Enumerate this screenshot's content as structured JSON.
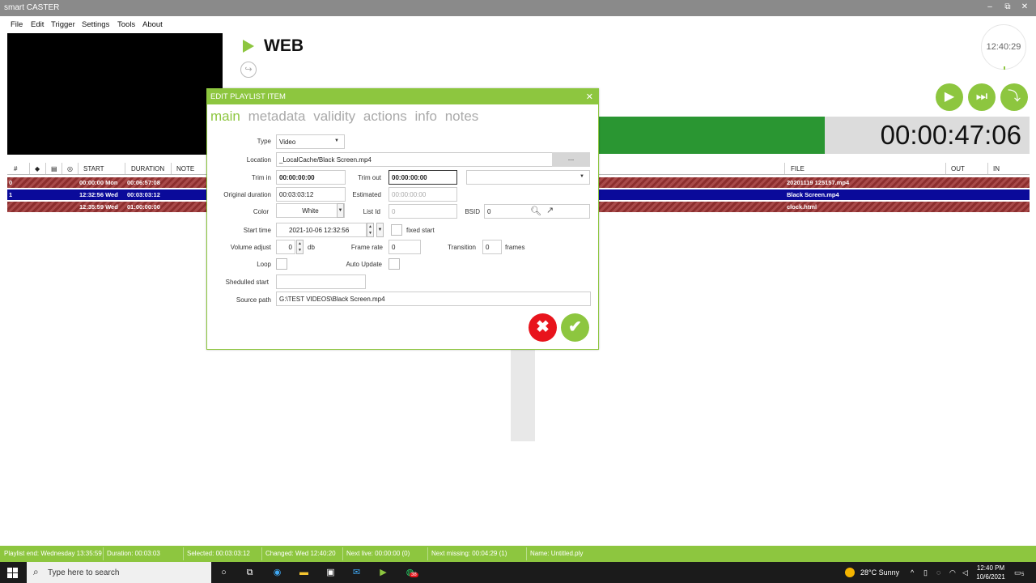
{
  "app": {
    "title": "smart CASTER"
  },
  "window_controls": {
    "minimize": "–",
    "restore": "⧉",
    "close": "✕"
  },
  "menu": [
    "File",
    "Edit",
    "Trigger",
    "Settings",
    "Tools",
    "About"
  ],
  "channel": {
    "name": "WEB",
    "sub_icon": "↪"
  },
  "clock": {
    "time": "12:40:29"
  },
  "controls": {
    "play": "▶",
    "next": "⏭",
    "skip": "⤵"
  },
  "countdown": "00:00:47:06",
  "playlist": {
    "headers": {
      "num": "#",
      "start": "START",
      "duration": "DURATION",
      "note": "NOTE",
      "file": "FILE",
      "out": "OUT",
      "in": "IN"
    },
    "rows": [
      {
        "num": "0",
        "start": "00:00:00 Mon",
        "duration": "00:06:57:08",
        "file": "20201119 125157.mp4",
        "style": "hatch"
      },
      {
        "num": "1",
        "start": "12:32:56 Wed",
        "duration": "00:03:03:12",
        "file": "Black Screen.mp4",
        "style": "sel"
      },
      {
        "num": "",
        "start": "12:35:59 Wed",
        "duration": "01:00:00:00",
        "file": "clock.html",
        "style": "hatch"
      }
    ]
  },
  "dialog": {
    "title": "EDIT PLAYLIST ITEM",
    "close": "✕",
    "tabs": [
      "main",
      "metadata",
      "validity",
      "actions",
      "info",
      "notes"
    ],
    "labels": {
      "type": "Type",
      "location": "Location",
      "trim_in": "Trim in",
      "trim_out": "Trim out",
      "original_duration": "Original duration",
      "estimated": "Estimated",
      "color": "Color",
      "list_id": "List Id",
      "bsid": "BSID",
      "start_time": "Start time",
      "fixed_start": "fixed start",
      "volume_adjust": "Volume adjust",
      "db": "db",
      "frame_rate": "Frame rate",
      "transition": "Transition",
      "frames": "frames",
      "loop": "Loop",
      "auto_update": "Auto Update",
      "scheduled_start": "Shedulled start",
      "source_path": "Source path"
    },
    "values": {
      "type": "Video",
      "location": "_LocalCache/Black Screen.mp4",
      "browse": "...",
      "trim_in": "00:00:00:00",
      "trim_out": "00:00:00:00",
      "original_duration": "00:03:03:12",
      "estimated": "00:00:00:00",
      "color": "White",
      "list_id": "0",
      "bsid": "0",
      "start_time": "2021-10-06 12:32:56",
      "volume_adjust": "0",
      "frame_rate": "0",
      "transition": "0",
      "scheduled_start": "",
      "source_path": "G:\\TEST VIDEOS\\Black Screen.mp4"
    },
    "buttons": {
      "cancel": "✖",
      "ok": "✔"
    }
  },
  "statusbar": [
    "Playlist end:  Wednesday 13:35:59",
    "Duration:  00:03:03",
    "Selected:  00:03:03:12",
    "Changed:  Wed 12:40:20",
    "Next live:  00:00:00  (0)",
    "Next missing:  00:04:29  (1)",
    "Name:  Untitled.ply"
  ],
  "taskbar": {
    "search_placeholder": "Type here to search",
    "weather": "28°C  Sunny",
    "time": "12:40 PM",
    "date": "10/6/2021",
    "notif_count": "5",
    "badge": "38"
  }
}
